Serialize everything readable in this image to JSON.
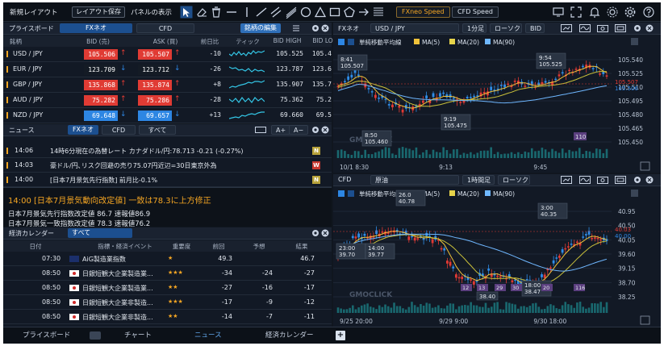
{
  "colors": {
    "bg": "#10161f",
    "up": "#e03b34",
    "down": "#2d86e3",
    "accent": "#1c4f8f",
    "highlight": "#f5a623"
  },
  "toolbar": {
    "new_layout": "新規レイアウト",
    "save_layout": "レイアウト保存",
    "panel_display": "パネルの表示",
    "fxneo": "FXneo Speed",
    "cfd": "CFD Speed"
  },
  "board": {
    "title": "プライスボード",
    "tab_fx": "FXネオ",
    "tab_cfd": "CFD",
    "edit": "銘柄の編集",
    "headers": [
      "銘柄",
      "BID (売)",
      "ASK (買)",
      "前日比",
      "ティック",
      "BID HIGH",
      "BID LO"
    ],
    "rows": [
      {
        "pair": "USD / JPY",
        "bid": "105.506",
        "ask": "105.507",
        "chg": "-10",
        "high": "105.525",
        "low": "105.4",
        "dir": "up"
      },
      {
        "pair": "EUR / JPY",
        "bid": "123.709",
        "ask": "123.712",
        "chg": "-26",
        "high": "123.787",
        "low": "123.6",
        "dir": "down"
      },
      {
        "pair": "GBP / JPY",
        "bid": "135.868",
        "ask": "135.874",
        "chg": "+8",
        "high": "135.907",
        "low": "135.7",
        "dir": "up"
      },
      {
        "pair": "AUD / JPY",
        "bid": "75.282",
        "ask": "75.286",
        "chg": "-28",
        "high": "75.362",
        "low": "75.2",
        "dir": "up"
      },
      {
        "pair": "NZD / JPY",
        "bid": "69.648",
        "ask": "69.657",
        "chg": "+13",
        "high": "69.660",
        "low": "69.5",
        "dir": "down"
      }
    ]
  },
  "news": {
    "title": "ニュース",
    "tab_fx": "FXネオ",
    "tab_cfd": "CFD",
    "tab_all": "すべて",
    "font_up": "A+",
    "font_down": "A−",
    "items": [
      {
        "time": "14:06",
        "text": "14時6分現在の為替レート カナダドル/円:78.713 -0.21 (-0.27%)",
        "badge": "N"
      },
      {
        "time": "14:03",
        "text": "豪ドル/円､リスク回避の売り75.07円近辺=30日東京外為",
        "badge": "W"
      },
      {
        "time": "14:00",
        "text": "[日本7月景気先行指数] 前月比-0.1%",
        "badge": "N"
      }
    ],
    "headline_time": "14:00",
    "headline": "[日本7月景気動向改定値] 一致は78.3に上方修正",
    "body1": "日本7月景気先行指数改定値 86.7 速報値86.9",
    "body2": "日本7月景気一致指数改定値 78.3 速報値76.2"
  },
  "calendar": {
    "title": "経済カレンダー",
    "filter": "すべて",
    "headers": [
      "日付",
      "指標・経済イベント",
      "重要度",
      "前回",
      "予想",
      "結果"
    ],
    "rows": [
      {
        "time": "07:30",
        "flag": "AU",
        "event": "AiG製造業指数",
        "stars": "★",
        "prev": "49.3",
        "fore": "",
        "res": "46.7"
      },
      {
        "time": "08:50",
        "flag": "JP",
        "event": "日銀短観大企業製造業...",
        "stars": "★★★",
        "prev": "-34",
        "fore": "-24",
        "res": "-27"
      },
      {
        "time": "08:50",
        "flag": "JP",
        "event": "日銀短観大企業製造業...",
        "stars": "★★",
        "prev": "-27",
        "fore": "-16",
        "res": "-17"
      },
      {
        "time": "08:50",
        "flag": "JP",
        "event": "日銀短観大企業非製造...",
        "stars": "★★★",
        "prev": "-17",
        "fore": "-9",
        "res": "-12"
      },
      {
        "time": "08:50",
        "flag": "JP",
        "event": "日銀短観大企業非製造...",
        "stars": "★★",
        "prev": "-14",
        "fore": "-7",
        "res": "-11"
      }
    ]
  },
  "bottom_tabs": [
    "プライスボード",
    "チャート",
    "ニュース",
    "経済カレンダー"
  ],
  "chart1": {
    "market": "FXネオ",
    "symbol": "USD / JPY",
    "interval": "1分足",
    "ctype": "ローソク",
    "side": "BID",
    "indicator": "単純移動平均線",
    "ma": [
      "MA(5)",
      "MA(20)",
      "MA(90)"
    ],
    "price_labels": [
      "105.540",
      "105.525",
      "105.510",
      "105.495",
      "105.480",
      "105.465",
      "105.450"
    ],
    "time_labels": [
      "10/1 8:30",
      "9:13",
      "9:45"
    ],
    "annotations": [
      {
        "t": "8:41",
        "p": "105.507"
      },
      {
        "t": "9:54",
        "p": "105.525"
      },
      {
        "t": "9:19",
        "p": "105.475"
      },
      {
        "t": "8:50",
        "p": "105.460"
      }
    ],
    "last_up": "105.507",
    "last_dn": "105.506",
    "count": "110",
    "watermark": "GMOCLICK"
  },
  "chart2": {
    "market": "CFD",
    "symbol": "原油",
    "interval": "1時間足",
    "ctype": "ローソク",
    "indicator": "単純移動平均線",
    "ma": [
      "MA(5)",
      "MA(20)",
      "MA(90)"
    ],
    "price_labels": [
      "40.95",
      "40.50",
      "40.05",
      "39.60",
      "39.15",
      "38.70",
      "38.25"
    ],
    "time_labels": [
      "9/25 20:00",
      "9/29 9:00",
      "9/30 18:00"
    ],
    "annotations": [
      {
        "t": "26.0",
        "p": "40.78"
      },
      {
        "t": "3:00",
        "p": "40.35"
      },
      {
        "t": "23:00",
        "p": "39.70"
      },
      {
        "t": "14:00",
        "p": "39.77"
      },
      {
        "t": "18:00",
        "p": "38.47"
      },
      {
        "t": "",
        "p": "38.40"
      }
    ],
    "last_up": "40.03",
    "last_dn": "40.00",
    "markers": [
      "12",
      "13",
      "29",
      "30",
      "20",
      "116"
    ],
    "watermark": "GMOCLICK"
  }
}
